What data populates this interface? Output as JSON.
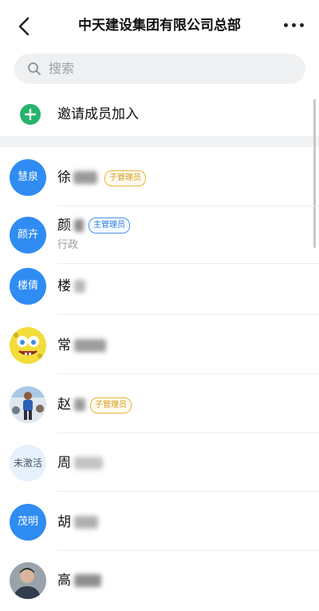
{
  "header": {
    "title": "中天建设集团有限公司总部"
  },
  "search": {
    "placeholder": "搜索"
  },
  "invite": {
    "label": "邀请成员加入"
  },
  "members": [
    {
      "avatar_text": "慧泉",
      "name": "徐",
      "badge": "子管理员"
    },
    {
      "avatar_text": "颜卉",
      "name": "颜",
      "badge": "主管理员",
      "dept": "行政"
    },
    {
      "avatar_text": "楼倩",
      "name": "楼"
    },
    {
      "avatar_icon": "sponge-cartoon-avatar",
      "name": "常"
    },
    {
      "avatar_icon": "runner-photo-avatar",
      "name": "赵",
      "badge": "子管理员"
    },
    {
      "avatar_text": "未激活",
      "name": "周"
    },
    {
      "avatar_text": "茂明",
      "name": "胡"
    },
    {
      "avatar_icon": "person-photo-avatar",
      "name": "高"
    }
  ],
  "colors": {
    "avatar_blue": "#2f8cf2",
    "invite_green": "#27b36a",
    "sub_admin": "#d39b19",
    "main_admin": "#2b7de9"
  }
}
